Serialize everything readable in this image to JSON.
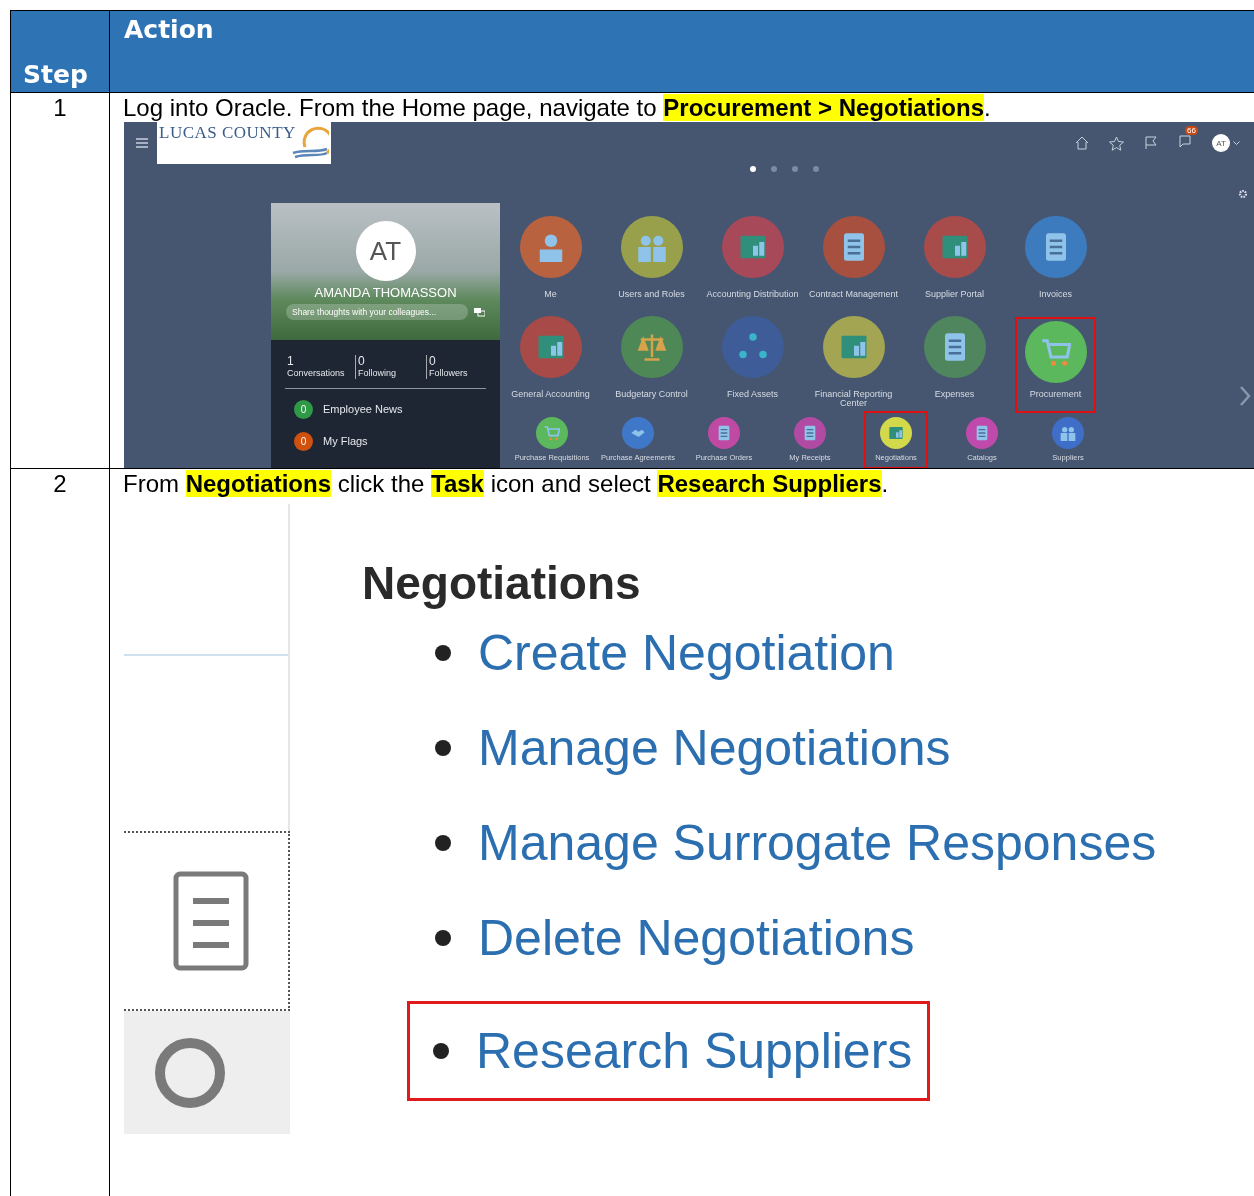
{
  "table": {
    "columns": [
      "Step",
      "Action"
    ],
    "rows": [
      {
        "step": "1",
        "instruction": "Log into Oracle. From the Home page, navigate to **Procurement > Negotiations**.",
        "screenshot": {
          "kind": "home",
          "logo": "LUCAS COUNTY",
          "notification_count": "66",
          "avatar": "AT",
          "pages": [
            {
              "selected": true
            },
            {
              "selected": false
            },
            {
              "selected": false
            },
            {
              "selected": false
            }
          ],
          "profile": {
            "initials": "AT",
            "name": "AMANDA THOMASSON",
            "placeholder": "Share thoughts with your colleagues...",
            "stats": [
              {
                "count": "1",
                "label": "Conversations"
              },
              {
                "count": "0",
                "label": "Following"
              },
              {
                "count": "0",
                "label": "Followers"
              }
            ],
            "feeds": [
              {
                "count": "0",
                "label": "Employee News",
                "color": "#2e9a48"
              },
              {
                "count": "0",
                "label": "My Flags",
                "color": "#d0500e"
              }
            ]
          },
          "tiles": [
            {
              "label": "Me",
              "color": "#b9623f",
              "highlighted": false
            },
            {
              "label": "Users and Roles",
              "color": "#98a04c",
              "highlighted": false
            },
            {
              "label": "Accounting Distribution",
              "color": "#a8495a",
              "highlighted": false
            },
            {
              "label": "Contract Management",
              "color": "#a8503f",
              "highlighted": false
            },
            {
              "label": "Supplier Portal",
              "color": "#a84b4b",
              "highlighted": false
            },
            {
              "label": "Invoices",
              "color": "#3c7bbd",
              "highlighted": false
            },
            {
              "label": "General Accounting",
              "color": "#a84b48",
              "highlighted": false
            },
            {
              "label": "Budgetary Control",
              "color": "#4e8857",
              "highlighted": false
            },
            {
              "label": "Fixed Assets",
              "color": "#3d5c98",
              "highlighted": false
            },
            {
              "label": "Financial Reporting Center",
              "color": "#a3a552",
              "highlighted": false
            },
            {
              "label": "Expenses",
              "color": "#4f865d",
              "highlighted": false
            },
            {
              "label": "Procurement",
              "color": "#5cb85c",
              "highlighted": true
            }
          ],
          "apps": [
            {
              "label": "Purchase Requisitions",
              "color": "#5cb85c",
              "highlighted": false
            },
            {
              "label": "Purchase Agreements",
              "color": "#3f78c8",
              "highlighted": false
            },
            {
              "label": "Purchase Orders",
              "color": "#c04aa3",
              "highlighted": false
            },
            {
              "label": "My Receipts",
              "color": "#b04aa3",
              "highlighted": false
            },
            {
              "label": "Negotiations",
              "color": "#d2d94a",
              "highlighted": true
            },
            {
              "label": "Catalogs",
              "color": "#c04aab",
              "highlighted": false
            },
            {
              "label": "Suppliers",
              "color": "#3f6ec8",
              "highlighted": false
            }
          ]
        }
      },
      {
        "step": "2",
        "instruction": "From **Negotiations** click the **Task** icon and select **Research Suppliers**.",
        "screenshot": {
          "kind": "tasks",
          "heading": "Negotiations",
          "tasks": [
            {
              "label": "Create Negotiation",
              "highlighted": false
            },
            {
              "label": "Manage Negotiations",
              "highlighted": false
            },
            {
              "label": "Manage Surrogate Responses",
              "highlighted": false
            },
            {
              "label": "Delete Negotiations",
              "highlighted": false
            },
            {
              "label": "Research Suppliers",
              "highlighted": true
            }
          ]
        }
      }
    ]
  }
}
